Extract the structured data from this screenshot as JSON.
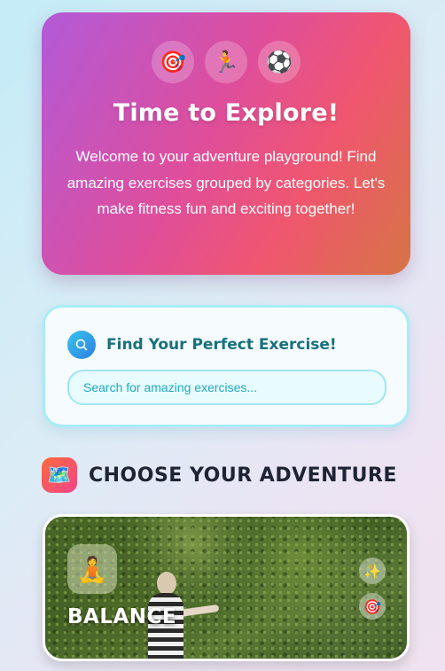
{
  "hero": {
    "icons": [
      {
        "name": "target-icon",
        "glyph": "🎯"
      },
      {
        "name": "runner-icon",
        "glyph": "🏃"
      },
      {
        "name": "soccer-ball-icon",
        "glyph": "⚽"
      }
    ],
    "title": "Time to Explore!",
    "text": "Welcome to your adventure playground! Find amazing exercises grouped by categories. Let's make fitness fun and exciting together!"
  },
  "search": {
    "title": "Find Your Perfect Exercise!",
    "placeholder": "Search for amazing exercises...",
    "value": ""
  },
  "section": {
    "icon": "🗺️",
    "title": "CHOOSE YOUR ADVENTURE"
  },
  "categories": [
    {
      "title": "BALANCE",
      "icon": "🧘",
      "badges": [
        {
          "name": "sparkles-icon",
          "glyph": "✨"
        },
        {
          "name": "target-icon",
          "glyph": "🎯"
        }
      ]
    }
  ],
  "colors": {
    "accent_teal": "#16707f",
    "search_border": "#a8ecf6",
    "hero_gradient_start": "#b25ad9",
    "hero_gradient_end": "#d67445"
  }
}
